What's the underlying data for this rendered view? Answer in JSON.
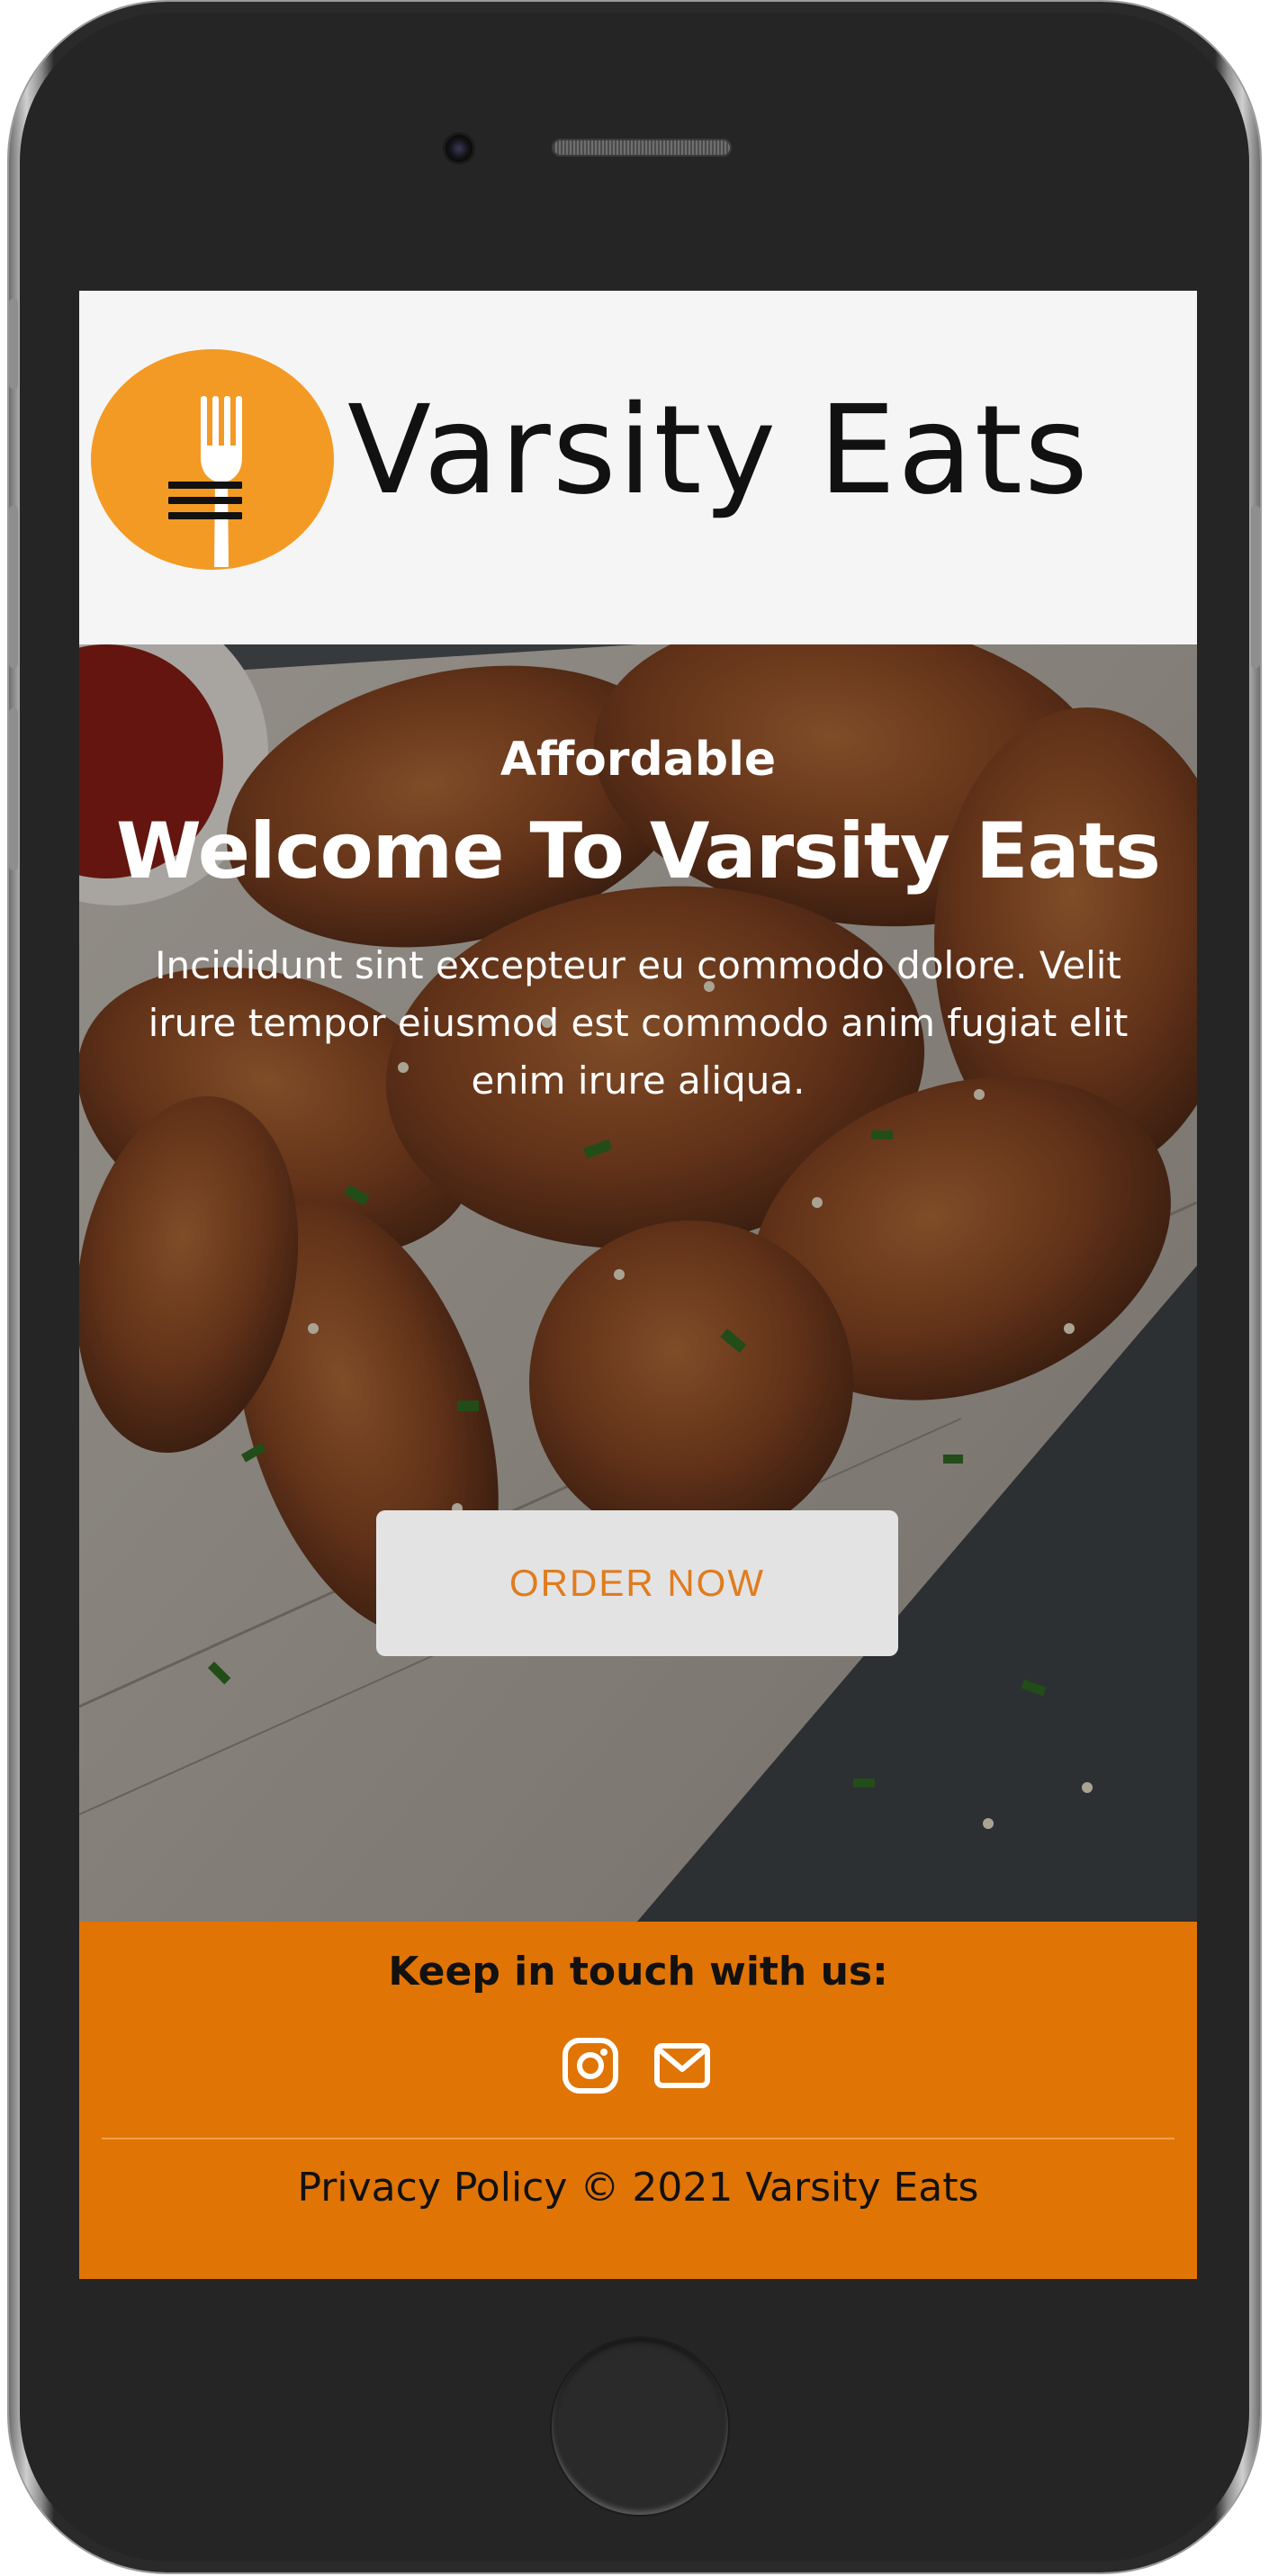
{
  "header": {
    "brand_name": "Varsity Eats",
    "menu_icon": "hamburger-menu-icon",
    "logo_icon": "fork-icon",
    "logo_color": "#f39a24"
  },
  "hero": {
    "subtitle": "Affordable",
    "title": "Welcome To Varsity Eats",
    "description": "Incididunt sint excepteur eu commodo dolore. Velit irure tempor eiusmod est commodo anim fugiat elit enim irure aliqua.",
    "cta_label": "ORDER NOW",
    "background": "chicken-wings-photo"
  },
  "footer": {
    "heading": "Keep in touch with us:",
    "social_icons": [
      "instagram-icon",
      "mail-icon"
    ],
    "copyright": "Privacy Policy © 2021 Varsity Eats",
    "background_color": "#e07405"
  }
}
